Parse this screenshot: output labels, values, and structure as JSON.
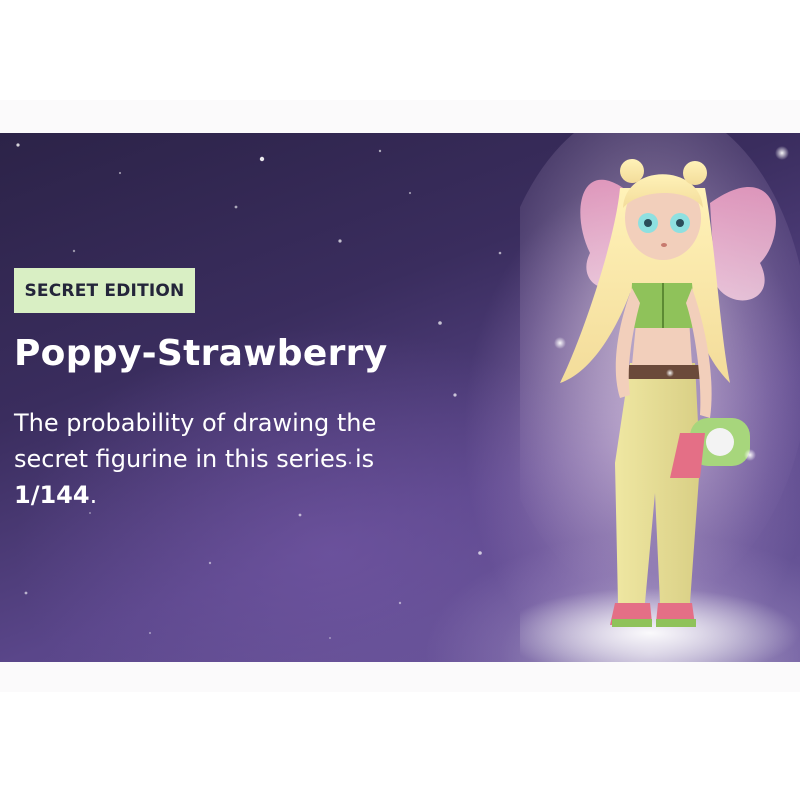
{
  "banner": {
    "badge": "SECRET EDITION",
    "title": "Poppy-Strawberry",
    "description": "The probability of drawing the secret figurine in this series is",
    "odds": "1/144",
    "odds_suffix": "."
  },
  "icons": {
    "figure": "fairy-figurine-illustration"
  },
  "colors": {
    "badge_background": "#d9efc4",
    "badge_text": "#24253a",
    "banner_dark": "#2c2348",
    "banner_light": "#6c5a9c",
    "text": "#ffffff"
  }
}
